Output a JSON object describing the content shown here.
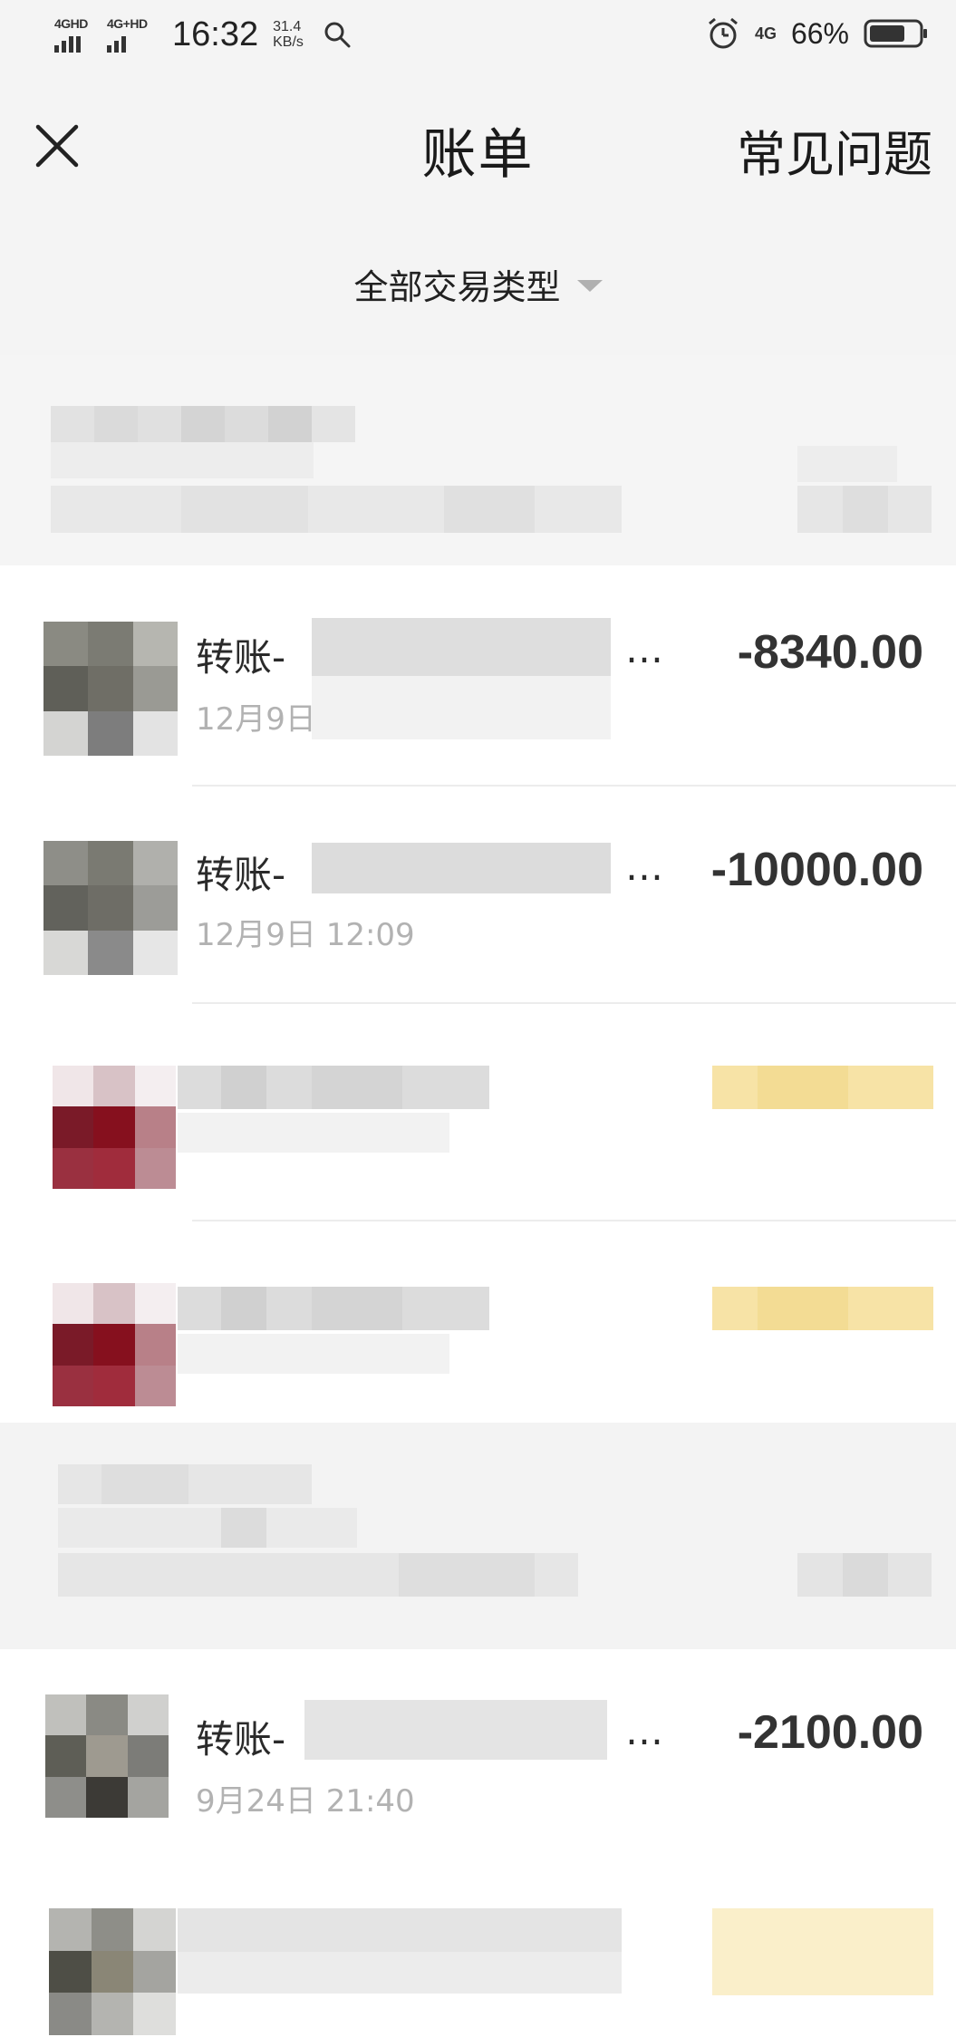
{
  "status_bar": {
    "signal1_label": "4GHD",
    "signal2_label": "4G+HD",
    "time": "16:32",
    "speed_value": "31.4",
    "speed_unit": "KB/s",
    "net_label": "4G",
    "battery": "66%",
    "icons": [
      "search-icon",
      "alarm-icon",
      "battery-icon"
    ]
  },
  "header": {
    "title": "账单",
    "faq": "常见问题",
    "filter": "全部交易类型",
    "close_icon": "close-icon",
    "filter_icon": "caret-down-icon"
  },
  "transactions": [
    {
      "title": "转账-",
      "ellipsis": "…",
      "time": "12月9日",
      "amount": "-8340.00"
    },
    {
      "title": "转账-",
      "ellipsis": "…",
      "time": "12月9日 12:09",
      "amount": "-10000.00"
    },
    {
      "title": "转账-",
      "ellipsis": "…",
      "time": "9月24日 21:40",
      "amount": "-2100.00"
    }
  ],
  "colors": {
    "background": "#ffffff",
    "header_bg": "#f4f4f4",
    "amount_text": "#333333",
    "time_text": "#b2b2b2",
    "caret": "#b0b0b0"
  }
}
